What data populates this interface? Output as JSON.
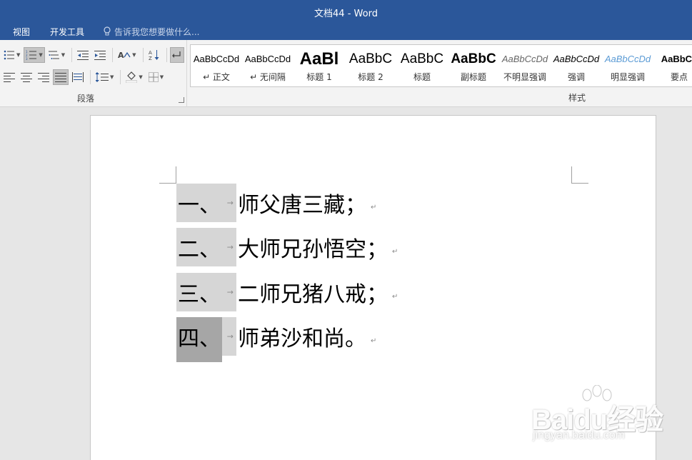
{
  "window": {
    "title": "文档44 - Word"
  },
  "tabs": [
    {
      "label": "视图"
    },
    {
      "label": "开发工具"
    }
  ],
  "tell_me": {
    "placeholder": "告诉我您想要做什么..."
  },
  "ribbon": {
    "paragraph_group_label": "段落",
    "styles_group_label": "样式",
    "styles": [
      {
        "preview": "AaBbCcDd",
        "name": "↵ 正文"
      },
      {
        "preview": "AaBbCcDd",
        "name": "↵ 无间隔"
      },
      {
        "preview": "AaBl",
        "name": "标题 1"
      },
      {
        "preview": "AaBbC",
        "name": "标题 2"
      },
      {
        "preview": "AaBbC",
        "name": "标题"
      },
      {
        "preview": "AaBbC",
        "name": "副标题"
      },
      {
        "preview": "AaBbCcDd",
        "name": "不明显强调"
      },
      {
        "preview": "AaBbCcDd",
        "name": "强调"
      },
      {
        "preview": "AaBbCcDd",
        "name": "明显强调"
      },
      {
        "preview": "AaBbCc",
        "name": "要点"
      }
    ]
  },
  "document": {
    "items": [
      {
        "number": "一、",
        "text": "师父唐三藏；"
      },
      {
        "number": "二、",
        "text": "大师兄孙悟空；"
      },
      {
        "number": "三、",
        "text": "二师兄猪八戒；"
      },
      {
        "number": "四、",
        "text": "师弟沙和尚。"
      }
    ],
    "tab_mark": "→",
    "para_mark": "↵"
  },
  "watermark": {
    "main": "Baidu经验",
    "sub": "jingyan.baidu.com"
  },
  "colors": {
    "title_bar": "#2b579a",
    "selection": "#d6d6d6",
    "selection_dark": "#a6a6a6"
  }
}
